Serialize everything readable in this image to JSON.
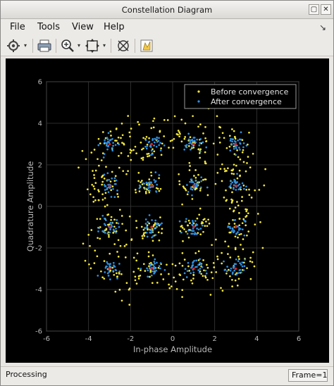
{
  "window": {
    "title": "Constellation Diagram"
  },
  "menu": {
    "items": [
      "File",
      "Tools",
      "View",
      "Help"
    ]
  },
  "toolbar": {
    "icons": [
      "gear-icon",
      "print-icon",
      "zoom-in-icon",
      "fit-to-view-icon",
      "center-icon",
      "marker-icon"
    ]
  },
  "status": {
    "text": "Processing",
    "frame": "Frame=1"
  },
  "chart_data": {
    "type": "scatter",
    "xlabel": "In-phase Amplitude",
    "ylabel": "Quadrature Amplitude",
    "xlim": [
      -6,
      6
    ],
    "ylim": [
      -6,
      6
    ],
    "xticks": [
      -6,
      -4,
      -2,
      0,
      2,
      4,
      6
    ],
    "yticks": [
      -6,
      -4,
      -2,
      0,
      2,
      4,
      6
    ],
    "grid": true,
    "legend_position": "top-right",
    "background": "#000000",
    "series": [
      {
        "name": "Before convergence",
        "color": "#f4e83a",
        "description_points": "distorted ring-shaped scatter around 16-QAM points",
        "points": []
      },
      {
        "name": "After convergence",
        "color": "#2f8fe0",
        "clusters": [
          [
            -3,
            3
          ],
          [
            -1,
            3
          ],
          [
            1,
            3
          ],
          [
            3,
            3
          ],
          [
            -3,
            1
          ],
          [
            -1,
            1
          ],
          [
            1,
            1
          ],
          [
            3,
            1
          ],
          [
            -3,
            -1
          ],
          [
            -1,
            -1
          ],
          [
            1,
            -1
          ],
          [
            3,
            -1
          ],
          [
            -3,
            -3
          ],
          [
            -1,
            -3
          ],
          [
            1,
            -3
          ],
          [
            3,
            -3
          ]
        ],
        "points": []
      }
    ],
    "reference_color": "#e02020",
    "reference_points": [
      [
        -3,
        3
      ],
      [
        -1,
        3
      ],
      [
        1,
        3
      ],
      [
        3,
        3
      ],
      [
        -3,
        1
      ],
      [
        -1,
        1
      ],
      [
        1,
        1
      ],
      [
        3,
        1
      ],
      [
        -3,
        -1
      ],
      [
        -1,
        -1
      ],
      [
        1,
        -1
      ],
      [
        3,
        -1
      ],
      [
        -3,
        -3
      ],
      [
        -1,
        -3
      ],
      [
        1,
        -3
      ],
      [
        3,
        -3
      ]
    ]
  }
}
